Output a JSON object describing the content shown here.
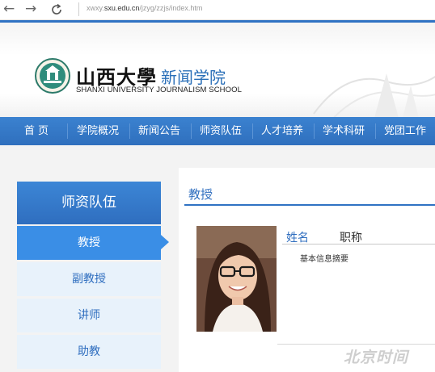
{
  "browser": {
    "back_icon": "arrow-left-icon",
    "forward_icon": "arrow-right-icon",
    "reload_icon": "reload-icon",
    "url_prefix": "xwxy.",
    "url_domain": "sxu.edu.cn",
    "url_path": "/jzyg/zzjs/index.htm"
  },
  "header": {
    "cn_name": "山西大學",
    "cn_sub": "新闻学院",
    "en_name": "SHANXI UNIVERSITY JOURNALISM SCHOOL"
  },
  "nav": {
    "items": [
      "首  页",
      "学院概况",
      "新闻公告",
      "师资队伍",
      "人才培养",
      "学术科研",
      "党团工作"
    ]
  },
  "sidebar": {
    "title": "师资队伍",
    "items": [
      {
        "label": "教授",
        "active": true
      },
      {
        "label": "副教授",
        "active": false
      },
      {
        "label": "讲师",
        "active": false
      },
      {
        "label": "助教",
        "active": false
      }
    ]
  },
  "content": {
    "section_title": "教授",
    "field_name": "姓名",
    "field_title": "职称",
    "summary": "基本信息摘要"
  },
  "watermark": "北京时间",
  "colors": {
    "primary_blue": "#2f72c3",
    "active_blue": "#3a8ee6",
    "sidebar_item_bg": "#e8f2fb"
  }
}
